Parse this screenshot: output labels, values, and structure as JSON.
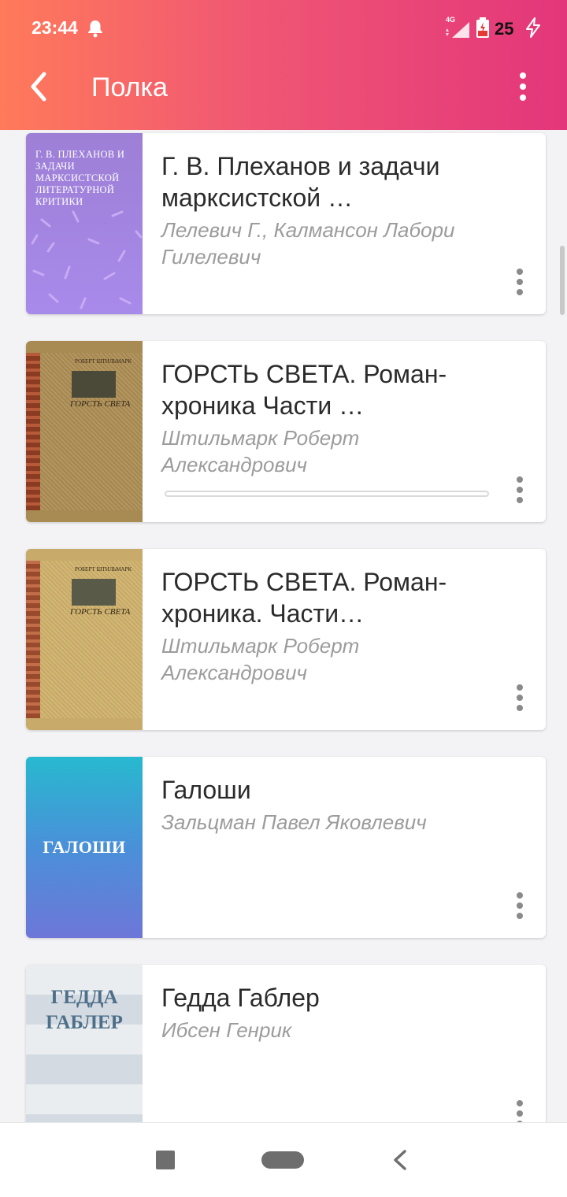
{
  "status_bar": {
    "time": "23:44",
    "network": "4G",
    "battery_level": "25"
  },
  "toolbar": {
    "title": "Полка",
    "back_icon": "chevron-left-icon",
    "menu_icon": "more-vert-icon"
  },
  "books": [
    {
      "title": "Г. В. Плеханов и задачи марксистской …",
      "author": "Лелевич Г., Калмансон Лабори Гилелевич",
      "cover_text": "Г. В. ПЛЕХАНОВ И ЗАДАЧИ МАРКСИСТСКОЙ ЛИТЕРАТУРНОЙ КРИТИКИ",
      "cover_color": "#9b7fe0"
    },
    {
      "title": "ГОРСТЬ СВЕТА. Роман-хроника Части …",
      "author": "Штильмарк Роберт Александрович",
      "cover_text": "ГОРСТЬ СВЕТА",
      "cover_publisher": "РОБЕРТ ШТИЛЬМАРК",
      "cover_color": "#a3884f",
      "progress": 0.0
    },
    {
      "title": "ГОРСТЬ СВЕТА. Роман-хроника. Части…",
      "author": "Штильмарк Роберт Александрович",
      "cover_text": "ГОРСТЬ СВЕТА",
      "cover_publisher": "РОБЕРТ ШТИЛЬМАРК",
      "cover_color": "#c9ad6c"
    },
    {
      "title": "Галоши",
      "author": "Зальцман Павел Яковлевич",
      "cover_text": "ГАЛОШИ",
      "cover_color": "#3a9fd0"
    },
    {
      "title": "Гедда Габлер",
      "author": "Ибсен Генрик",
      "cover_text": "ГЕДДА ГАБЛЕР",
      "cover_color": "#e4e8ec"
    }
  ],
  "nav_bar": {
    "recents_icon": "square-icon",
    "home_icon": "pill-home-icon",
    "back_icon": "triangle-back-icon"
  }
}
